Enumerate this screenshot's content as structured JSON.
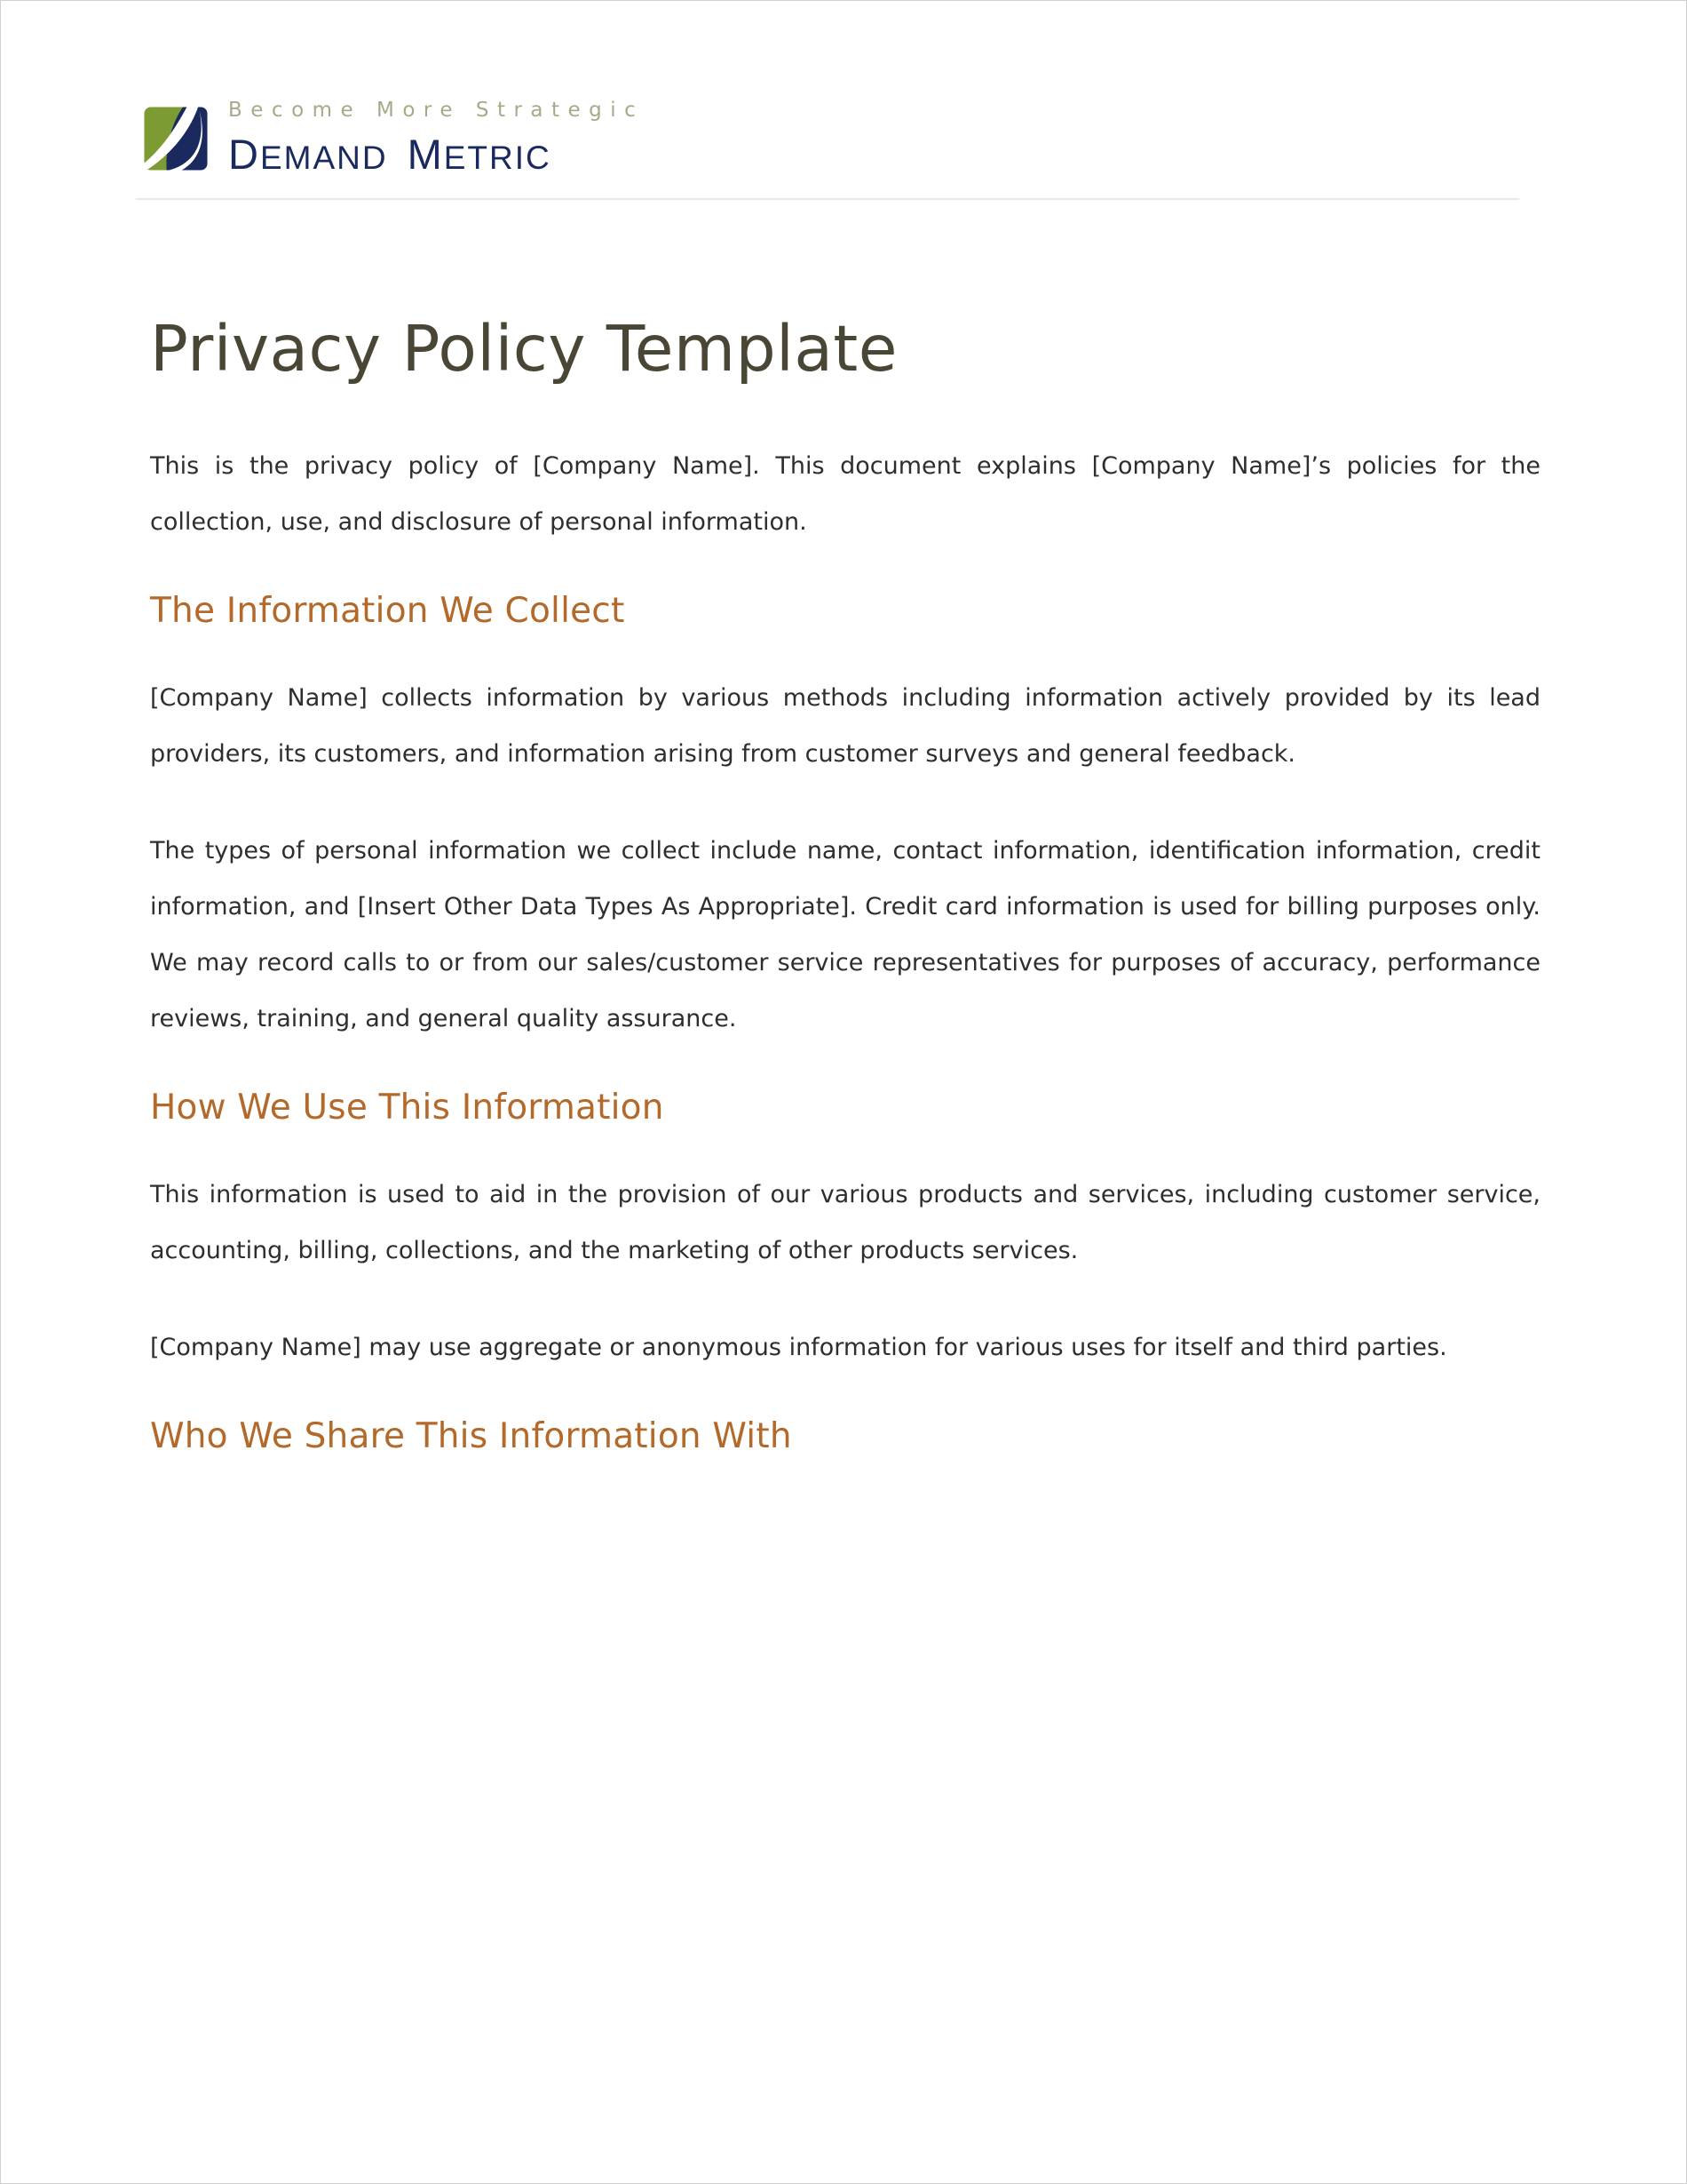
{
  "letterhead": {
    "logo_icon": "demand-metric-logo-icon",
    "tagline": "Become More Strategic",
    "wordmark_demand": "DEMAND",
    "wordmark_metric": "METRIC",
    "brand_green": "#7d9b33",
    "brand_navy": "#1b2a5e",
    "tagline_color": "#a9a98a"
  },
  "document": {
    "title": "Privacy Policy Template",
    "title_color": "#4a4635",
    "heading_color": "#b3692a",
    "body_color": "#2e2e2e",
    "intro_paragraph": "This is the privacy policy of [Company Name]. This document explains [Company Name]’s policies for the collection, use, and disclosure of personal information.",
    "sections": [
      {
        "heading": "The Information We Collect",
        "paragraphs": [
          "[Company Name] collects information by various methods including information actively provided by its lead providers, its customers, and information arising from customer surveys and general feedback.",
          "The types of personal information we collect include name, contact information, identification information, credit information, and [Insert Other Data Types As Appropriate]. Credit card information is used for billing purposes only. We may record calls to or from our sales/customer service representatives for purposes of accuracy, performance reviews, training, and general quality assurance."
        ]
      },
      {
        "heading": "How We Use This Information",
        "paragraphs": [
          "This information is used to aid in the provision of our various products and services, including customer service, accounting, billing, collections, and the marketing of other products services.",
          "[Company Name] may use aggregate or anonymous information for various uses for itself and third parties."
        ]
      },
      {
        "heading": "Who We Share This Information With",
        "paragraphs": []
      }
    ]
  }
}
